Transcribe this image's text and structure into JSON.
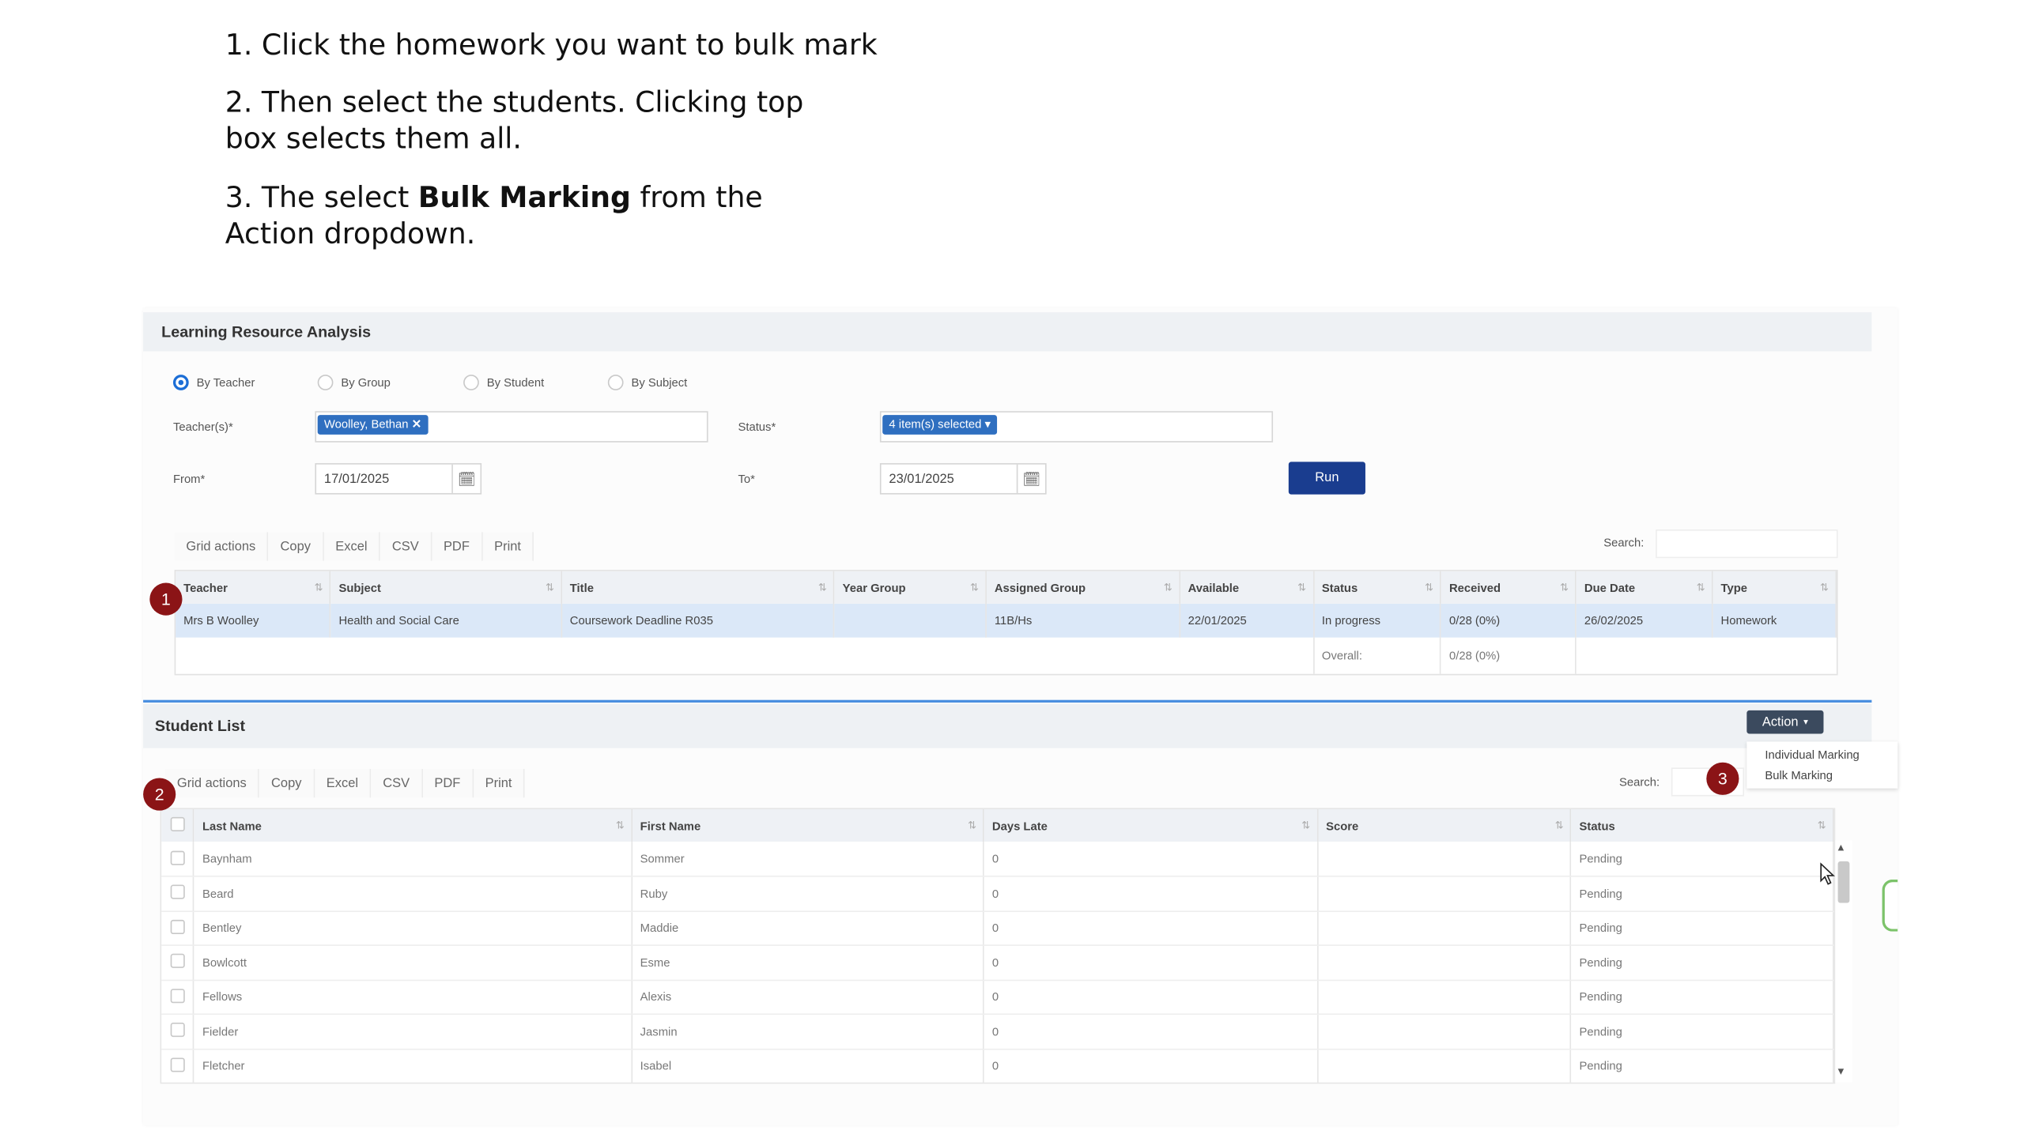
{
  "instructions": {
    "step1": "1. Click the homework you want to bulk mark",
    "step2": "2. Then select the students. Clicking top box selects them all.",
    "step3_pre": "3. The select ",
    "step3_bold": "Bulk Marking",
    "step3_post": " from the Action dropdown."
  },
  "lra": {
    "title": "Learning Resource Analysis",
    "radios": [
      "By Teacher",
      "By Group",
      "By Student",
      "By Subject"
    ],
    "selected_radio": "By Teacher",
    "teacher_label": "Teacher(s)*",
    "teacher_chip": "Woolley, Bethan",
    "status_label": "Status*",
    "status_value": "4 item(s) selected",
    "from_label": "From*",
    "from_value": "17/01/2025",
    "to_label": "To*",
    "to_value": "23/01/2025",
    "run_label": "Run",
    "grid_actions": "Grid actions",
    "toolbar": [
      "Copy",
      "Excel",
      "CSV",
      "PDF",
      "Print"
    ],
    "search_label": "Search:",
    "columns": [
      "Teacher",
      "Subject",
      "Title",
      "Year Group",
      "Assigned Group",
      "Available",
      "Status",
      "Received",
      "Due Date",
      "Type"
    ],
    "row": [
      "Mrs B Woolley",
      "Health and Social Care",
      "Coursework Deadline R035",
      "",
      "11B/Hs",
      "22/01/2025",
      "In progress",
      "0/28 (0%)",
      "26/02/2025",
      "Homework"
    ],
    "overall_label": "Overall:",
    "overall_value": "0/28 (0%)"
  },
  "students": {
    "title": "Student List",
    "action_label": "Action",
    "menu": [
      "Individual Marking",
      "Bulk Marking"
    ],
    "grid_actions": "Grid actions",
    "toolbar": [
      "Copy",
      "Excel",
      "CSV",
      "PDF",
      "Print"
    ],
    "search_label": "Search:",
    "columns": [
      "Last Name",
      "First Name",
      "Days Late",
      "Score",
      "Status"
    ],
    "rows": [
      [
        "Baynham",
        "Sommer",
        "0",
        "",
        "Pending"
      ],
      [
        "Beard",
        "Ruby",
        "0",
        "",
        "Pending"
      ],
      [
        "Bentley",
        "Maddie",
        "0",
        "",
        "Pending"
      ],
      [
        "Bowlcott",
        "Esme",
        "0",
        "",
        "Pending"
      ],
      [
        "Fellows",
        "Alexis",
        "0",
        "",
        "Pending"
      ],
      [
        "Fielder",
        "Jasmin",
        "0",
        "",
        "Pending"
      ],
      [
        "Fletcher",
        "Isabel",
        "0",
        "",
        "Pending"
      ]
    ]
  },
  "markers": [
    "1",
    "2",
    "3"
  ],
  "colors": {
    "accent": "#1c6ed6",
    "run": "#1a3d8f",
    "marker": "#8b1416",
    "selected_row": "#dbe8f8"
  }
}
